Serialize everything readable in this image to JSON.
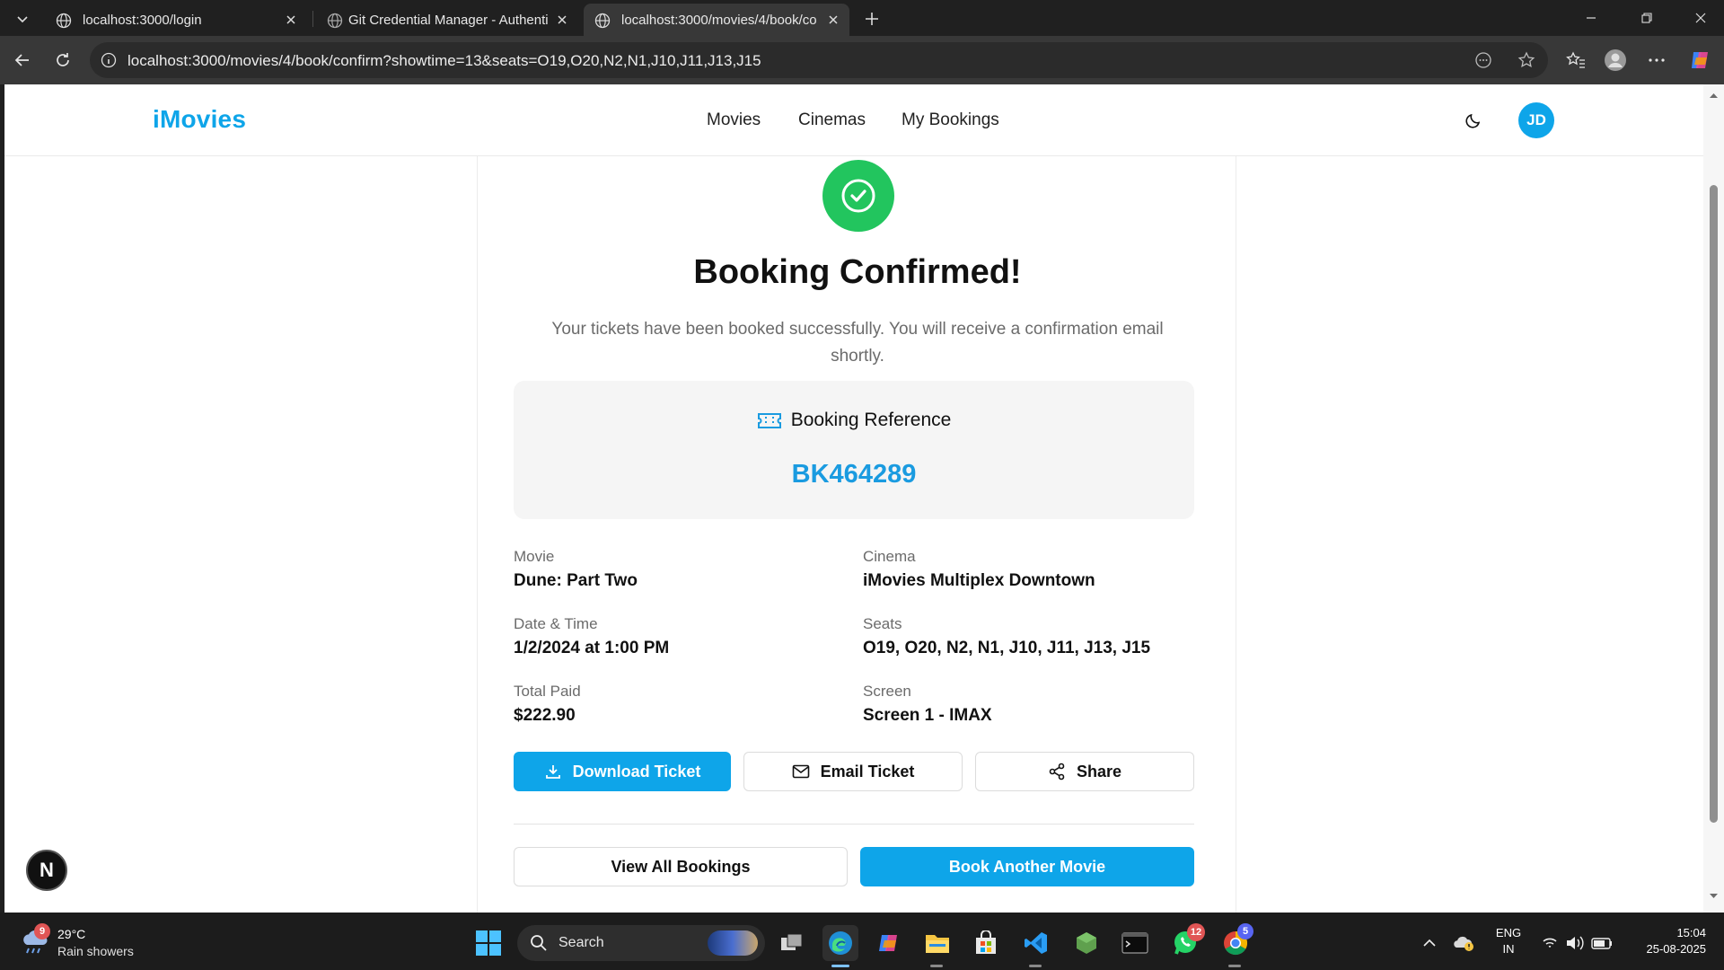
{
  "browser": {
    "tabs": [
      {
        "title": "localhost:3000/login"
      },
      {
        "title": "Git Credential Manager - Authenti"
      },
      {
        "title": "localhost:3000/movies/4/book/co"
      }
    ],
    "url": "localhost:3000/movies/4/book/confirm?showtime=13&seats=O19,O20,N2,N1,J10,J11,J13,J15"
  },
  "header": {
    "brand": "iMovies",
    "nav": [
      "Movies",
      "Cinemas",
      "My Bookings"
    ],
    "avatar_initials": "JD"
  },
  "confirmation": {
    "title": "Booking Confirmed!",
    "message": "Your tickets have been booked successfully. You will receive a confirmation email shortly.",
    "reference_label": "Booking Reference",
    "reference_code": "BK464289"
  },
  "details": {
    "movie": {
      "label": "Movie",
      "value": "Dune: Part Two"
    },
    "cinema": {
      "label": "Cinema",
      "value": "iMovies Multiplex Downtown"
    },
    "datetime": {
      "label": "Date & Time",
      "value": "1/2/2024 at 1:00 PM"
    },
    "seats": {
      "label": "Seats",
      "value": "O19, O20, N2, N1, J10, J11, J13, J15"
    },
    "total": {
      "label": "Total Paid",
      "value": "$222.90"
    },
    "screen": {
      "label": "Screen",
      "value": "Screen 1 - IMAX"
    }
  },
  "actions": {
    "download": "Download Ticket",
    "email": "Email Ticket",
    "share": "Share",
    "view_all": "View All Bookings",
    "book_another": "Book Another Movie"
  },
  "dev_badge": "N",
  "taskbar": {
    "weather_badge": "9",
    "temperature": "29°C",
    "condition": "Rain showers",
    "search_placeholder": "Search",
    "whatsapp_badge": "12",
    "chrome_badge": "5",
    "lang_line1": "ENG",
    "lang_line2": "IN",
    "time": "15:04",
    "date": "25-08-2025"
  },
  "colors": {
    "brand": "#0ea5e9",
    "success": "#22c55e",
    "reference": "#1a9be0"
  }
}
